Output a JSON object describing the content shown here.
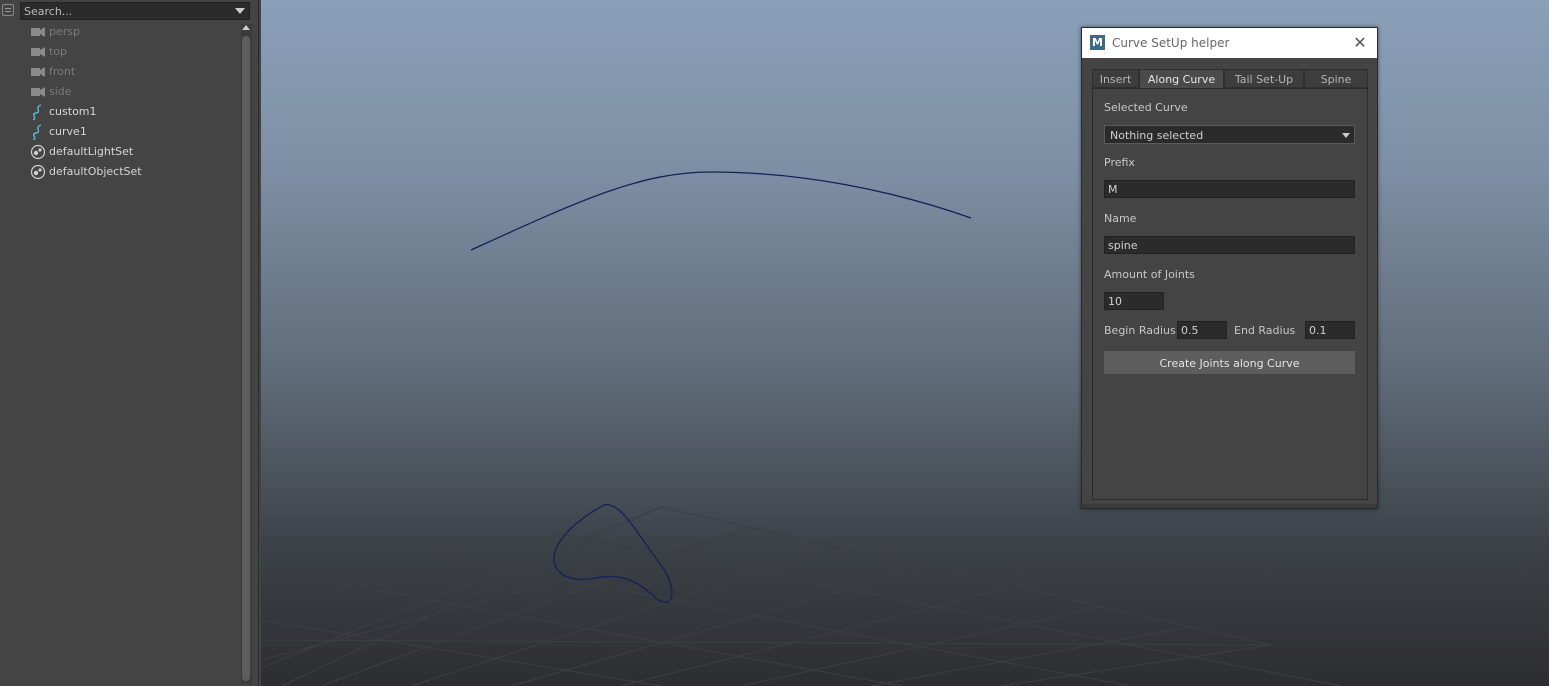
{
  "outliner": {
    "search_placeholder": "Search...",
    "items": [
      {
        "label": "persp",
        "icon": "camera-icon"
      },
      {
        "label": "top",
        "icon": "camera-icon"
      },
      {
        "label": "front",
        "icon": "camera-icon"
      },
      {
        "label": "side",
        "icon": "camera-icon"
      },
      {
        "label": "custom1",
        "icon": "curve-icon"
      },
      {
        "label": "curve1",
        "icon": "curve-icon"
      },
      {
        "label": "defaultLightSet",
        "icon": "set-icon"
      },
      {
        "label": "defaultObjectSet",
        "icon": "set-icon"
      }
    ]
  },
  "viewport": {
    "curve_color": "#14205a",
    "grid_color": "#3a3d41"
  },
  "dialog": {
    "app_icon_letter": "M",
    "title": "Curve SetUp helper",
    "close_symbol": "✕",
    "tabs": [
      {
        "label": "Insert",
        "active": false
      },
      {
        "label": "Along Curve",
        "active": true
      },
      {
        "label": "Tail Set-Up",
        "active": false
      },
      {
        "label": "Spine",
        "active": false
      }
    ],
    "selected_curve_label": "Selected Curve",
    "selected_curve_value": "Nothing selected",
    "prefix_label": "Prefix",
    "prefix_value": "M",
    "name_label": "Name",
    "name_value": "spine",
    "joints_label": "Amount of Joints",
    "joints_value": "10",
    "begin_radius_label": "Begin Radius",
    "begin_radius_value": "0.5",
    "end_radius_label": "End Radius",
    "end_radius_value": "0.1",
    "create_button": "Create Joints along Curve"
  }
}
